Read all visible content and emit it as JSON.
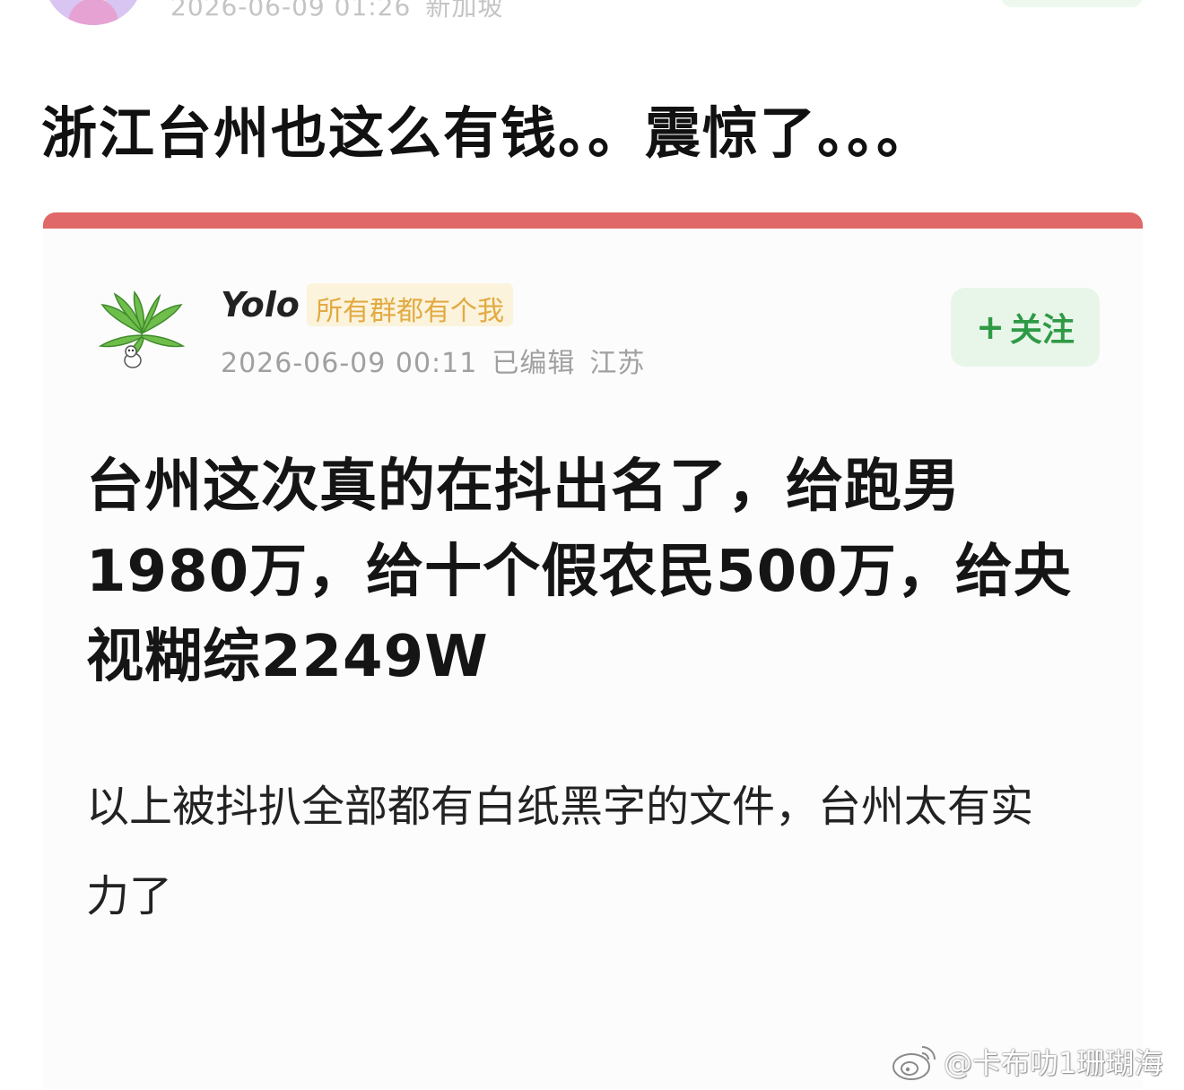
{
  "outer_post": {
    "datetime": "2026-06-09 01:26",
    "location": "新加坡",
    "text": "浙江台州也这么有钱。。震惊了。。。"
  },
  "quoted_post": {
    "user": {
      "name": "Yolo",
      "badge": "所有群都有个我",
      "datetime": "2026-06-09 00:11",
      "edited_label": "已编辑",
      "location": "江苏"
    },
    "follow_button": {
      "plus": "+",
      "label": "关注"
    },
    "title": "台州这次真的在抖出名了，给跑男1980万，给十个假农民500万，给央视糊综2249W",
    "body": "以上被抖扒全部都有白纸黑字的文件，台州太有实力了"
  },
  "watermark": {
    "text": "@卡布叻1珊瑚海"
  },
  "colors": {
    "card_top_bar": "#e06868",
    "follow_green": "#2f9a45",
    "badge_gold": "#e2aa42"
  }
}
